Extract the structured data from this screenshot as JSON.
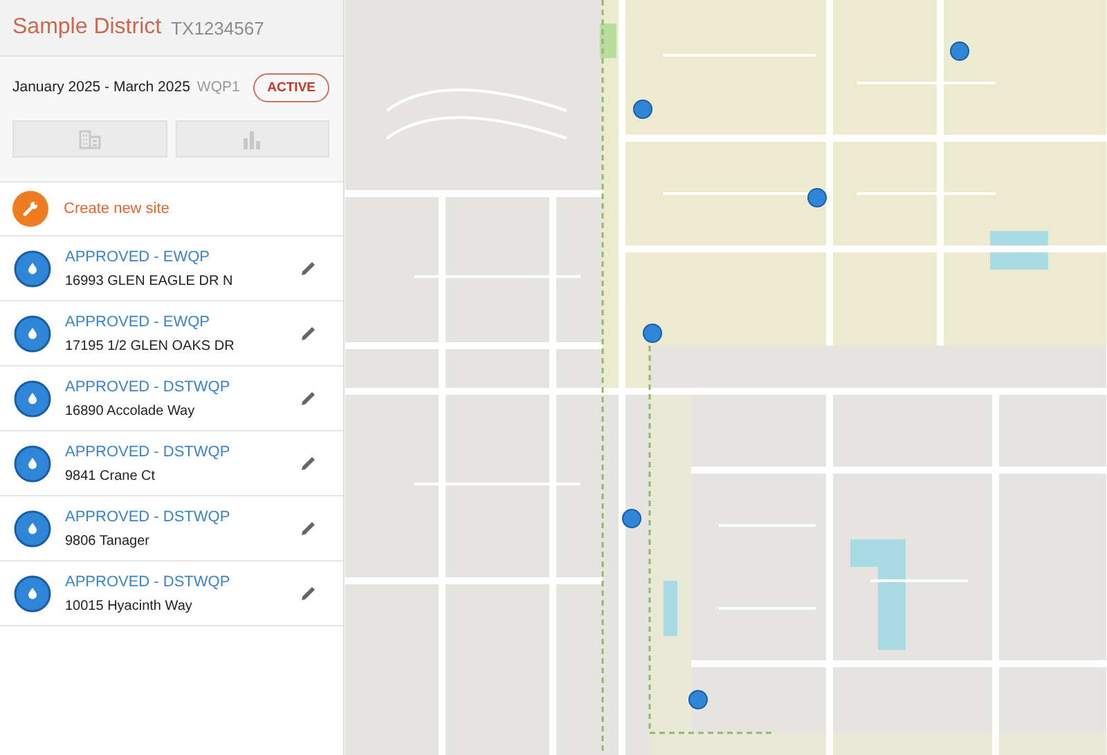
{
  "header": {
    "title": "Sample District",
    "code": "TX1234567"
  },
  "period": {
    "range": "January 2025 - March 2025",
    "program": "WQP1",
    "status": "ACTIVE"
  },
  "create_action": {
    "label": "Create new site"
  },
  "sites": [
    {
      "status": "APPROVED - EWQP",
      "address": "16993 GLEN EAGLE DR N"
    },
    {
      "status": "APPROVED - EWQP",
      "address": "17195 1/2 GLEN OAKS DR"
    },
    {
      "status": "APPROVED - DSTWQP",
      "address": "16890 Accolade Way"
    },
    {
      "status": "APPROVED - DSTWQP",
      "address": "9841 Crane Ct"
    },
    {
      "status": "APPROVED - DSTWQP",
      "address": "9806 Tanager"
    },
    {
      "status": "APPROVED - DSTWQP",
      "address": "10015 Hyacinth Way"
    }
  ]
}
